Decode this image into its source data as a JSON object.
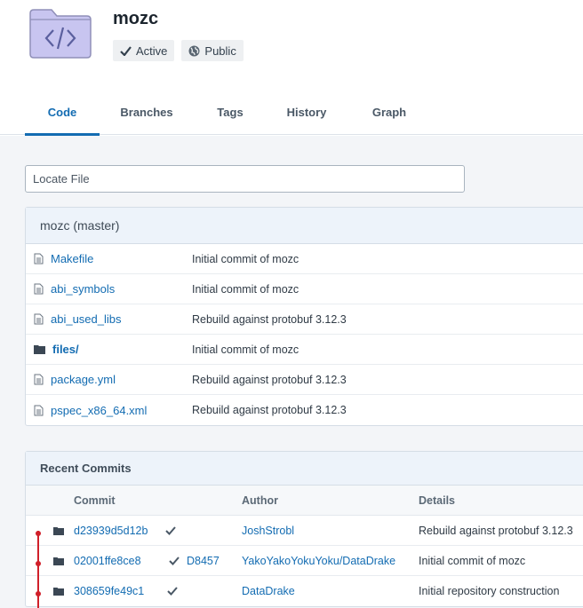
{
  "repo": {
    "title": "mozc",
    "badges": [
      {
        "label": "Active",
        "icon": "checkmark-icon"
      },
      {
        "label": "Public",
        "icon": "globe-icon"
      }
    ]
  },
  "tabs": [
    {
      "label": "Code",
      "active": true
    },
    {
      "label": "Branches",
      "active": false
    },
    {
      "label": "Tags",
      "active": false
    },
    {
      "label": "History",
      "active": false
    },
    {
      "label": "Graph",
      "active": false
    }
  ],
  "locate": {
    "placeholder": "Locate File"
  },
  "files_panel": {
    "title": "mozc (master)",
    "rows": [
      {
        "name": "Makefile",
        "type": "file",
        "message": "Initial commit of mozc"
      },
      {
        "name": "abi_symbols",
        "type": "file",
        "message": "Initial commit of mozc"
      },
      {
        "name": "abi_used_libs",
        "type": "file",
        "message": "Rebuild against protobuf 3.12.3"
      },
      {
        "name": "files/",
        "type": "dir",
        "message": "Initial commit of mozc"
      },
      {
        "name": "package.yml",
        "type": "file",
        "message": "Rebuild against protobuf 3.12.3"
      },
      {
        "name": "pspec_x86_64.xml",
        "type": "file",
        "message": "Rebuild against protobuf 3.12.3"
      }
    ]
  },
  "commits_panel": {
    "title": "Recent Commits",
    "columns": {
      "commit": "Commit",
      "author": "Author",
      "details": "Details"
    },
    "rows": [
      {
        "hash": "d23939d5d12b",
        "revision": "",
        "author": "JoshStrobl",
        "details": "Rebuild against protobuf 3.12.3"
      },
      {
        "hash": "02001ffe8ce8",
        "revision": "D8457",
        "author": "YakoYakoYokuYoku/DataDrake",
        "details": "Initial commit of mozc"
      },
      {
        "hash": "308659fe49c1",
        "revision": "",
        "author": "DataDrake",
        "details": "Initial repository construction"
      }
    ]
  },
  "colors": {
    "accent": "#136cb2",
    "graph": "#d0202a",
    "icon_purple": "#c5c3ee"
  }
}
